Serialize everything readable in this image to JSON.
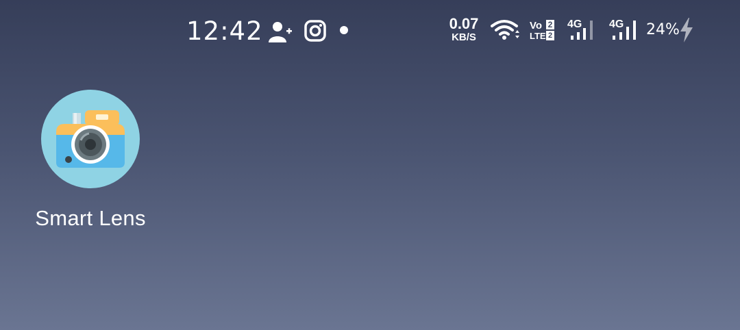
{
  "status_bar": {
    "time": "12:42",
    "notification_icons": [
      "add-contact-icon",
      "instagram-icon",
      "dot-icon"
    ],
    "net_speed_value": "0.07",
    "net_speed_unit": "KB/S",
    "volte_top": "Vo",
    "volte_bottom": "LTE",
    "sim_number": "2",
    "sim1_network": "4G",
    "sim2_network": "4G",
    "battery_percent": "24%",
    "charging": true
  },
  "home": {
    "apps": [
      {
        "label": "Smart Lens",
        "icon": "camera-icon"
      }
    ]
  },
  "colors": {
    "icon_circle": "#8fd3e4",
    "camera_top": "#fbbf5b",
    "camera_body": "#56b8e9",
    "lens_gray": "#6c7a80"
  }
}
